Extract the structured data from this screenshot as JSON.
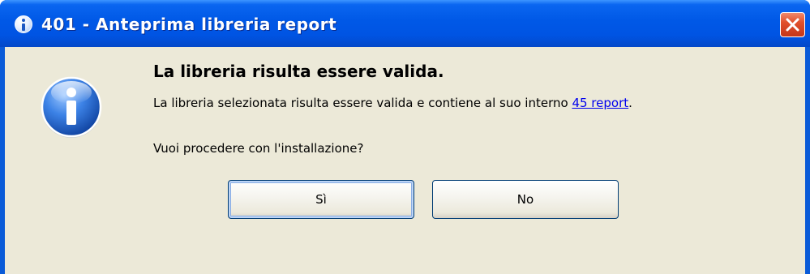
{
  "window": {
    "title": "401 - Anteprima libreria report",
    "title_icon": "info-icon",
    "close_icon": "close-icon"
  },
  "dialog": {
    "icon": "info-icon",
    "heading": "La libreria risulta essere valida.",
    "message_prefix": "La libreria selezionata risulta essere valida e contiene al suo interno ",
    "message_link": "45 report",
    "message_suffix": ".",
    "question": "Vuoi procedere con l'installazione?"
  },
  "buttons": {
    "yes_label": "Sì",
    "no_label": "No"
  },
  "colors": {
    "titlebar": "#0054e3",
    "client_background": "#ece9d8",
    "close_button": "#e1502b",
    "link": "#0000ee",
    "button_border": "#003c74"
  }
}
